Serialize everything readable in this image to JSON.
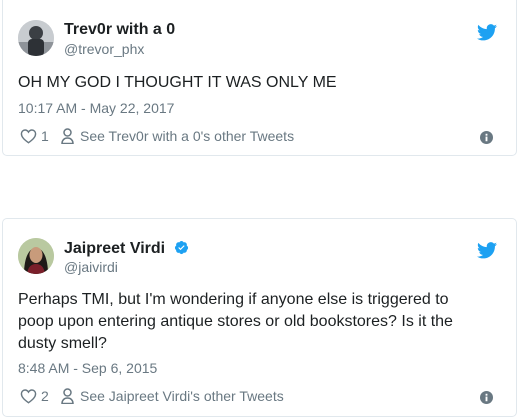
{
  "tweets": [
    {
      "author_name": "Trev0r with a 0",
      "handle": "@trevor_phx",
      "verified": false,
      "text": "OH MY GOD I THOUGHT IT WAS ONLY ME",
      "timestamp": "10:17 AM - May 22, 2017",
      "like_count": "1",
      "other_tweets_label": "See Trev0r with a 0's other Tweets"
    },
    {
      "author_name": "Jaipreet Virdi",
      "handle": "@jaivirdi",
      "verified": true,
      "text": "Perhaps TMI, but I'm wondering if anyone else is triggered to poop upon entering antique stores or old bookstores? Is it the dusty smell?",
      "timestamp": "8:48 AM - Sep 6, 2015",
      "like_count": "2",
      "other_tweets_label": "See Jaipreet Virdi's other Tweets"
    }
  ],
  "colors": {
    "twitter_blue": "#1da1f2",
    "text": "#1c2022",
    "muted": "#697882",
    "border": "#e1e8ed"
  },
  "icons": [
    "twitter-bird-icon",
    "heart-icon",
    "person-icon",
    "info-icon",
    "verified-badge-icon",
    "avatar"
  ]
}
